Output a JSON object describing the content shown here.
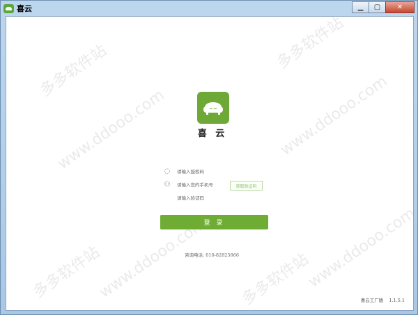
{
  "window": {
    "title": "喜云",
    "controls": {
      "minimize": "▁",
      "maximize": "▢",
      "close": "✕"
    }
  },
  "watermark": {
    "texts": [
      "多多软件站",
      "www.ddooo.com"
    ]
  },
  "brand": {
    "name": "喜 云",
    "color": "#6ea938"
  },
  "form": {
    "auth_code_placeholder": "请输入授权码",
    "phone_placeholder": "请输入您的手机号",
    "verify_code_placeholder": "请输入验证码",
    "get_code_label": "获取验证码",
    "login_label": "登 录"
  },
  "footer": {
    "hotline": "咨询电话: 010-82825866",
    "vendor": "喜云工厂版",
    "version": "1.1.5.1"
  },
  "colors": {
    "accent": "#6fac33",
    "link": "#8cbf6a"
  }
}
